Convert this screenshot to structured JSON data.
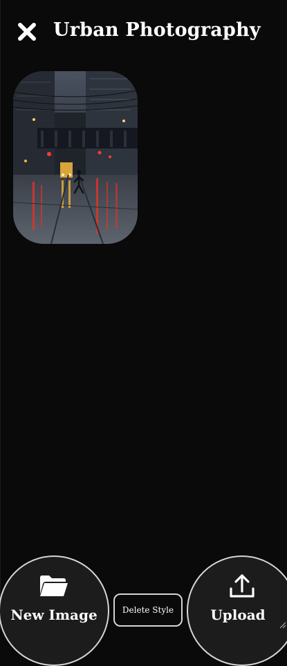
{
  "header": {
    "title": "Urban Photography",
    "close_icon": "close-x-icon"
  },
  "gallery": {
    "items": [
      {
        "description_icon": "photo-thumbnail"
      }
    ]
  },
  "footer": {
    "new_image_label": "New Image",
    "new_image_icon": "folder-icon",
    "delete_style_label": "Delete Style",
    "upload_label": "Upload",
    "upload_icon": "upload-icon"
  },
  "colors": {
    "background": "#0a0a0a",
    "button_fill": "#1c1c1c",
    "border": "#d6d6d6",
    "text": "#ffffff"
  }
}
